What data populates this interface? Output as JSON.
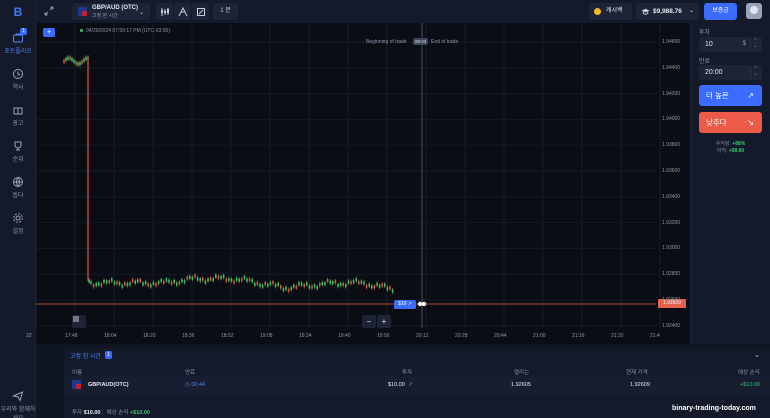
{
  "sidebar": {
    "logo": "B",
    "badge": "1",
    "items": [
      {
        "label": "포트폴리오",
        "icon": "portfolio-icon"
      },
      {
        "label": "역사",
        "icon": "history-icon"
      },
      {
        "label": "광고",
        "icon": "promo-icon"
      },
      {
        "label": "순위",
        "icon": "trophy-icon"
      },
      {
        "label": "돕다",
        "icon": "globe-icon"
      },
      {
        "label": "설정",
        "icon": "settings-icon"
      }
    ],
    "support_label": "우리와 함께하세요"
  },
  "topbar": {
    "asset_name": "GBP/AUD (OTC)",
    "asset_sub": "고정 된 시간",
    "timeframe": "1 분",
    "cashback": "캐시백",
    "balance": "$9,988.76",
    "deposit": "보증금"
  },
  "chart": {
    "datetime": "04/20/2024  07:59:17 PM  (UTC-03:00)",
    "beginning_label": "Beginning of trade",
    "end_label": "End of trade",
    "timer": "00:43",
    "current_price": "1.92609",
    "trade_tag": "$10",
    "y_ticks": [
      "1.94600",
      "1.94400",
      "1.94200",
      "1.94000",
      "1.93800",
      "1.93600",
      "1.93400",
      "1.93200",
      "1.93000",
      "1.92800",
      "1.92600",
      "1.92400"
    ],
    "x_ticks": [
      "32",
      "17:48",
      "18:04",
      "18:20",
      "18:36",
      "18:52",
      "19:08",
      "19:24",
      "19:40",
      "19:56",
      "20:12",
      "20:28",
      "20:44",
      "21:00",
      "21:16",
      "21:32",
      "21:4"
    ],
    "btn_plus": "+",
    "btn_zoom_out": "−",
    "btn_zoom_in": "+"
  },
  "trade_panel": {
    "investment_label": "투자",
    "investment_value": "10",
    "currency": "$",
    "expiry_label": "만료",
    "expiry_value": "20:00",
    "higher_label": "더 높은",
    "lower_label": "낮추다",
    "payout_label": "수익성:",
    "payout_value": "+88%",
    "profit_label": "이익:",
    "profit_value": "+$8.80",
    "colors": {
      "higher": "#3c6cff",
      "lower": "#ec5a48",
      "positive": "#34c36b"
    }
  },
  "trades": {
    "tab_label": "고정 된 시간",
    "tab_count": "1",
    "headers": [
      "이름",
      "만료",
      "투자",
      "열리는",
      "현재 가격",
      "예상 손익"
    ],
    "rows": [
      {
        "name": "GBP/AUD(OTC)",
        "expiry": "00:44",
        "investment": "$10.00",
        "open": "1.92605",
        "current": "1.92609",
        "pnl": "+$10.00"
      }
    ],
    "total_invest_label": "투자",
    "total_invest": "$10.00",
    "total_pnl_label": "예상 손익",
    "total_pnl": "+$10.00"
  },
  "watermark": "binary-trading-today.com"
}
